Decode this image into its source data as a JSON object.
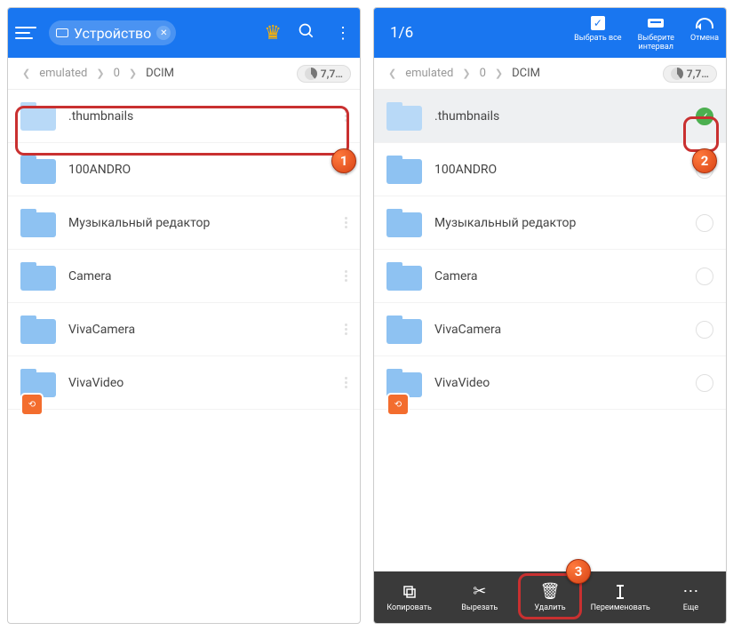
{
  "left": {
    "chip_label": "Устройство",
    "breadcrumb": [
      "emulated",
      "0",
      "DCIM"
    ],
    "storage": "7,7…",
    "folders": [
      ".thumbnails",
      "100ANDRO",
      "Музыкальный редактор",
      "Camera",
      "VivaCamera",
      "VivaVideo"
    ]
  },
  "right": {
    "selection_count": "1/6",
    "actions_top": {
      "select_all": "Выбрать все",
      "interval": "Выберите\nинтервал",
      "cancel": "Отмена"
    },
    "breadcrumb": [
      "emulated",
      "0",
      "DCIM"
    ],
    "storage": "7,7…",
    "folders": [
      ".thumbnails",
      "100ANDRO",
      "Музыкальный редактор",
      "Camera",
      "VivaCamera",
      "VivaVideo"
    ],
    "bottombar": {
      "copy": "Копировать",
      "cut": "Вырезать",
      "delete": "Удалить",
      "rename": "Переименовать",
      "more": "Еще"
    }
  },
  "badges": {
    "b1": "1",
    "b2": "2",
    "b3": "3"
  }
}
